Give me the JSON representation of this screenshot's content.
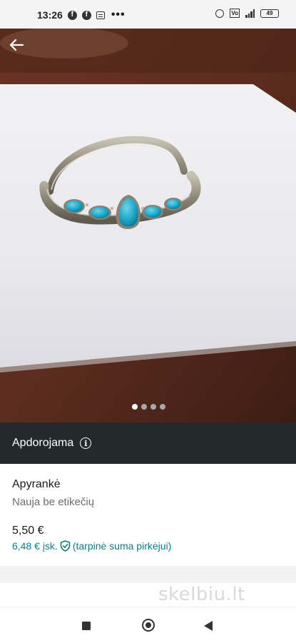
{
  "status_bar": {
    "time": "13:26",
    "battery": "49"
  },
  "listing": {
    "status_banner": "Apdorojama",
    "title": "Apyrankė",
    "condition": "Nauja be etikečių",
    "price": "5,50 €",
    "price_total": "6,48 € įsk.",
    "price_note": "(tarpinė suma pirkėjui)"
  },
  "gallery": {
    "image_count": 4,
    "active_index": 0
  },
  "watermark": "skelbiu.lt",
  "colors": {
    "banner_bg": "#242a2b",
    "accent": "#0d7d88",
    "turquoise": "#1fa8c9"
  }
}
